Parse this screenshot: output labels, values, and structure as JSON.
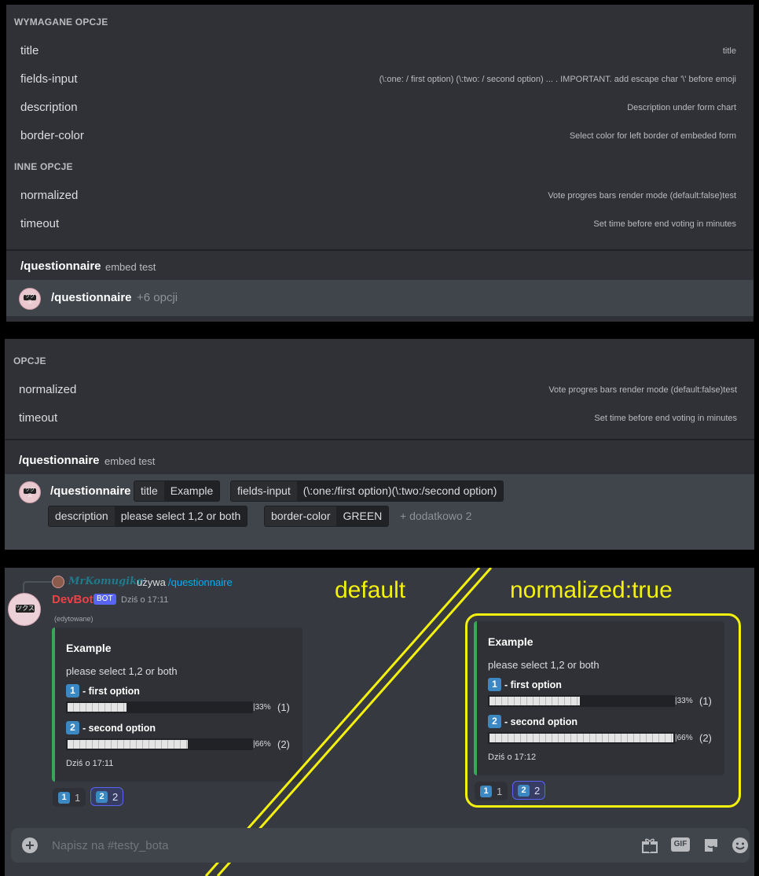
{
  "panel1": {
    "required_header": "WYMAGANE OPCJE",
    "required": [
      {
        "name": "title",
        "desc": "title"
      },
      {
        "name": "fields-input",
        "desc": "(\\:one: / first option) (\\:two: / second option) ... . IMPORTANT. add escape char '\\' before emoji"
      },
      {
        "name": "description",
        "desc": "Description under form chart"
      },
      {
        "name": "border-color",
        "desc": "Select color for left border of embeded form"
      }
    ],
    "other_header": "INNE OPCJE",
    "other": [
      {
        "name": "normalized",
        "desc": "Vote progres bars render mode (default:false)test"
      },
      {
        "name": "timeout",
        "desc": "Set time before end voting in minutes"
      }
    ],
    "command": "/questionnaire",
    "bot_name": "embed test",
    "input_command": "/questionnaire",
    "input_hint": "+6 opcji"
  },
  "panel2": {
    "header": "OPCJE",
    "options": [
      {
        "name": "normalized",
        "desc": "Vote progres bars render mode (default:false)test"
      },
      {
        "name": "timeout",
        "desc": "Set time before end voting in minutes"
      }
    ],
    "command": "/questionnaire",
    "bot_name": "embed test",
    "input_command": "/questionnaire",
    "chips": [
      {
        "key": "title",
        "value": "Example"
      },
      {
        "key": "fields-input",
        "value": "(\\:one:/first option)(\\:two:/second option)"
      },
      {
        "key": "description",
        "value": "please select 1,2 or both"
      },
      {
        "key": "border-color",
        "value": "GREEN"
      }
    ],
    "extra": "+ dodatkowo 2"
  },
  "panel3": {
    "reply_user": "MrKomugiko",
    "reply_uses": "używa",
    "reply_command": "/questionnaire",
    "author": "DevBot",
    "bot_badge": "BOT",
    "timestamp": "Dziś o 17:11",
    "edited": "(edytowane)",
    "label_default": "default",
    "label_normalized": "normalized:true",
    "embed_border_color": "#3ba55c",
    "annotation_color": "#f5f10e",
    "embed_default": {
      "title": "Example",
      "description": "please select 1,2 or both",
      "options": [
        {
          "key": "1",
          "label": "- first option",
          "percent_text": "|33%",
          "count_text": "(1)",
          "fill_fraction": 0.33
        },
        {
          "key": "2",
          "label": "- second option",
          "percent_text": "|66%",
          "count_text": "(2)",
          "fill_fraction": 0.66
        }
      ],
      "footer": "Dziś o 17:11",
      "reactions": [
        {
          "key": "1",
          "count": "1",
          "active": false
        },
        {
          "key": "2",
          "count": "2",
          "active": true
        }
      ]
    },
    "embed_normalized": {
      "title": "Example",
      "description": "please select 1,2 or both",
      "options": [
        {
          "key": "1",
          "label": "- first option",
          "percent_text": "|33%",
          "count_text": "(1)",
          "fill_fraction": 0.5
        },
        {
          "key": "2",
          "label": "- second option",
          "percent_text": "|66%",
          "count_text": "(2)",
          "fill_fraction": 1.0
        }
      ],
      "footer": "Dziś o 17:12",
      "reactions": [
        {
          "key": "1",
          "count": "1",
          "active": false
        },
        {
          "key": "2",
          "count": "2",
          "active": true
        }
      ]
    },
    "message_placeholder": "Napisz na #testy_bota",
    "toolbar_icons": [
      "gift-icon",
      "gif-icon",
      "sticker-icon",
      "emoji-icon"
    ],
    "gif_label": "GIF"
  }
}
